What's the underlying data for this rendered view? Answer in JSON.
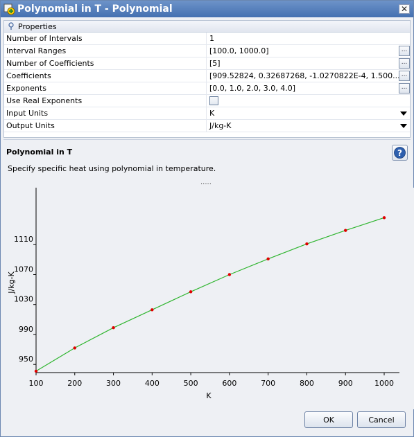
{
  "window": {
    "title": "Polynomial in T - Polynomial",
    "close_label": "✕"
  },
  "properties": {
    "header": "Properties",
    "rows": [
      {
        "name": "Number of Intervals",
        "value": "1"
      },
      {
        "name": "Interval Ranges",
        "value": "[100.0, 1000.0]"
      },
      {
        "name": "Number of Coefficients",
        "value": "[5]"
      },
      {
        "name": "Coefficients",
        "value": "[909.52824, 0.32687268, -1.0270822E-4, 1.500..."
      },
      {
        "name": "Exponents",
        "value": "[0.0, 1.0, 2.0, 3.0, 4.0]"
      },
      {
        "name": "Use Real Exponents",
        "value": ""
      },
      {
        "name": "Input Units",
        "value": "K"
      },
      {
        "name": "Output Units",
        "value": "J/kg-K"
      }
    ],
    "ellipsis_label": "..."
  },
  "help": {
    "title": "Polynomial in T",
    "text": "Specify specific heat using polynomial in temperature.",
    "icon_label": "?"
  },
  "splitter_grip": "·····",
  "chart_data": {
    "type": "line",
    "xlabel": "K",
    "ylabel": "J/kg-K",
    "x_ticks": [
      100,
      200,
      300,
      400,
      500,
      600,
      700,
      800,
      900,
      1000
    ],
    "y_ticks": [
      950,
      990,
      1030,
      1070,
      1110
    ],
    "xlim": [
      100,
      1000
    ],
    "ylim": [
      940,
      1150
    ],
    "series": [
      {
        "x": [
          100,
          200,
          300,
          400,
          500,
          600,
          700,
          800,
          900,
          1000
        ],
        "y": [
          941,
          972,
          999,
          1023,
          1047,
          1070,
          1091,
          1111,
          1129,
          1146
        ]
      }
    ],
    "line_color": "#2fb52f",
    "marker_color": "#e00000"
  },
  "buttons": {
    "ok": "OK",
    "cancel": "Cancel"
  }
}
